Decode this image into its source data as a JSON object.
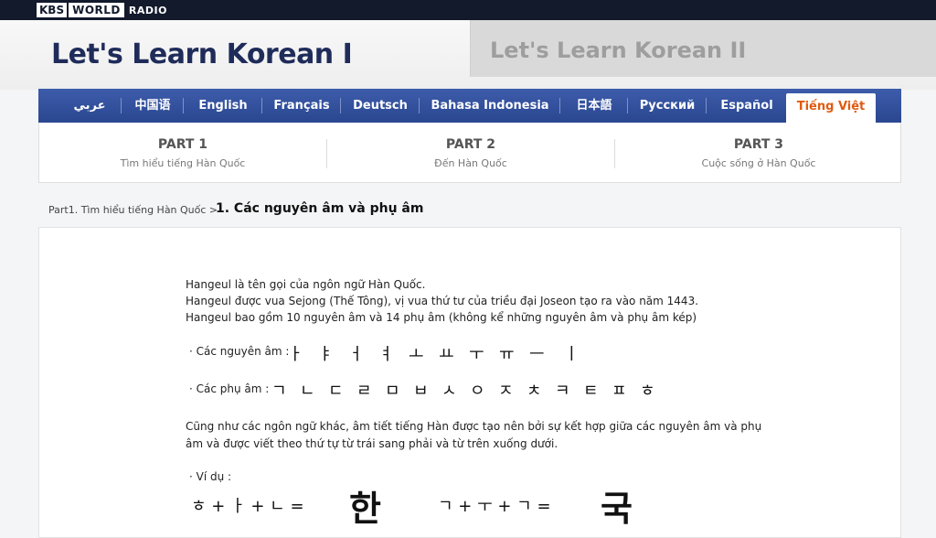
{
  "logo": {
    "kbs": "KBS",
    "world": "WORLD",
    "radio": "RADIO"
  },
  "header": {
    "title_active": "Let's Learn Korean I",
    "title_other": "Let's Learn Korean II"
  },
  "languages": [
    {
      "label": "عربي"
    },
    {
      "label": "中国语"
    },
    {
      "label": "English"
    },
    {
      "label": "Français"
    },
    {
      "label": "Deutsch"
    },
    {
      "label": "Bahasa Indonesia"
    },
    {
      "label": "日本語"
    },
    {
      "label": "Русский"
    },
    {
      "label": "Español"
    },
    {
      "label": "Tiếng Việt",
      "active": true
    }
  ],
  "parts": [
    {
      "title": "PART 1",
      "subtitle": "Tìm hiểu tiếng Hàn Quốc"
    },
    {
      "title": "PART 2",
      "subtitle": "Đến Hàn Quốc"
    },
    {
      "title": "PART 3",
      "subtitle": "Cuộc sống ở Hàn Quốc"
    }
  ],
  "breadcrumb": {
    "parent": "Part1. Tìm hiểu tiếng Hàn Quốc >",
    "current": "1. Các nguyên âm và phụ âm"
  },
  "content": {
    "intro": [
      "Hangeul là tên gọi của ngôn ngữ Hàn Quốc.",
      "Hangeul được vua Sejong (Thế Tông), vị vua thứ tư của triều đại Joseon tạo ra vào năm 1443.",
      "Hangeul bao gồm 10 nguyên âm và 14 phụ âm (không kể những nguyên âm và phụ âm kép)"
    ],
    "vowels_label": "· Các nguyên âm :",
    "vowels": [
      "ㅏ",
      "ㅑ",
      "ㅓ",
      "ㅕ",
      "ㅗ",
      "ㅛ",
      "ㅜ",
      "ㅠ",
      "ㅡ",
      "ㅣ"
    ],
    "consonants_label": "· Các phụ âm :",
    "consonants": [
      "ㄱ",
      "ㄴ",
      "ㄷ",
      "ㄹ",
      "ㅁ",
      "ㅂ",
      "ㅅ",
      "ㅇ",
      "ㅈ",
      "ㅊ",
      "ㅋ",
      "ㅌ",
      "ㅍ",
      "ㅎ"
    ],
    "para2": [
      "Cũng như các ngôn ngữ khác, âm tiết tiếng Hàn được tạo nên bởi sự kết hợp giữa các nguyên âm và phụ",
      "âm và được viết theo thứ tự từ trái sang phải và từ trên xuống dưới."
    ],
    "example_label": "· Ví dụ :",
    "example1": {
      "formula": "ㅎ + ㅏ + ㄴ =",
      "result": "한"
    },
    "example2": {
      "formula": "ㄱ + ㅜ + ㄱ =",
      "result": "국"
    }
  }
}
